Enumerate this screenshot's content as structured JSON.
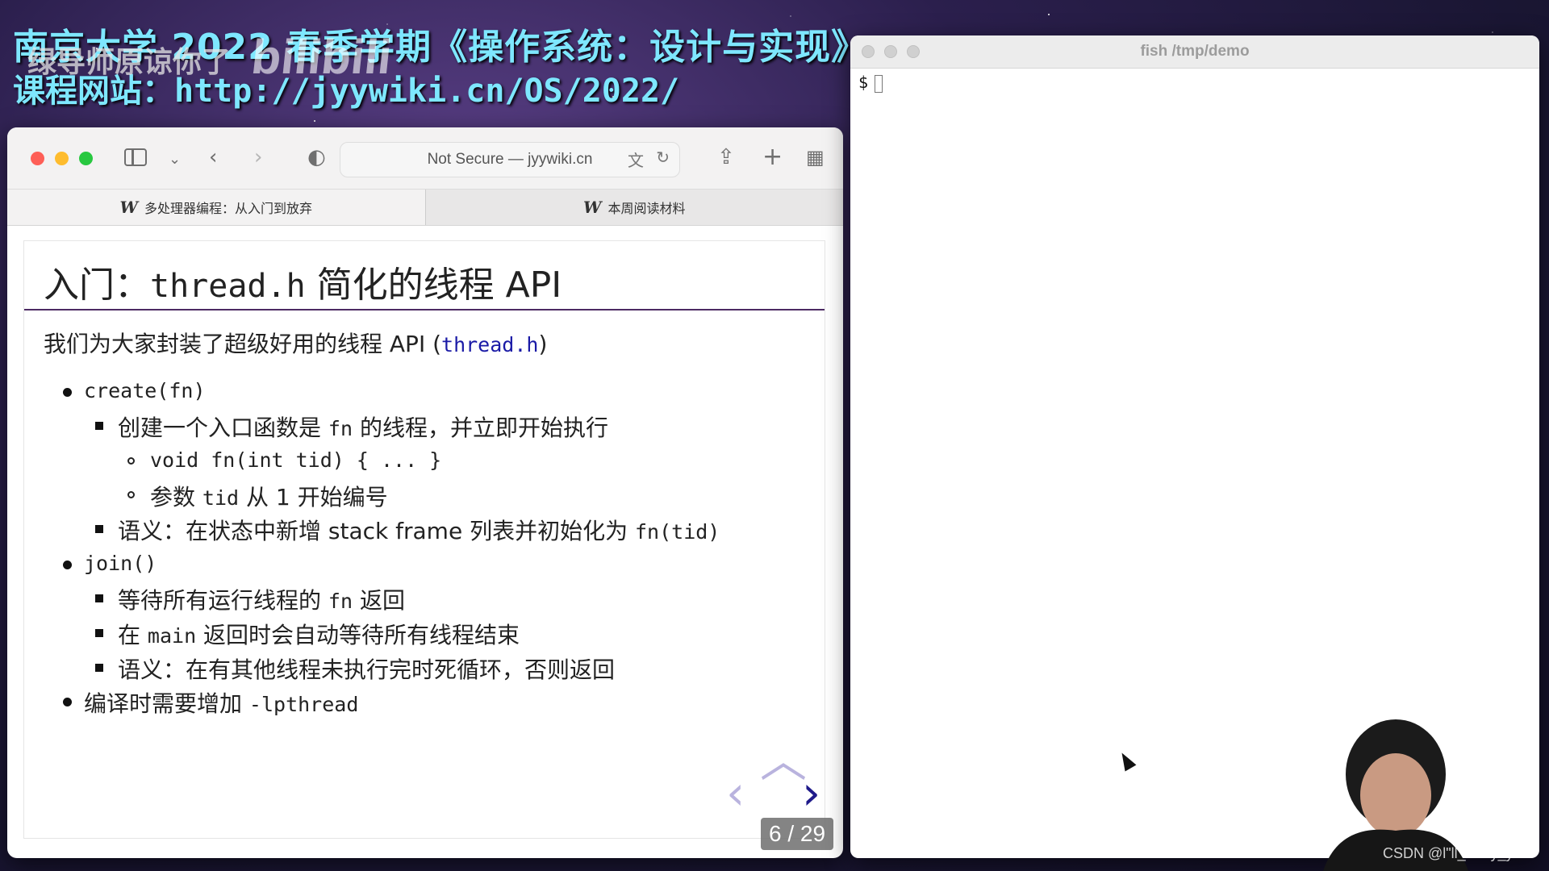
{
  "overlay": {
    "course_title": "南京大学 2022 春季学期《操作系统：设计与实现》",
    "course_site_label": "课程网站：",
    "course_site_url": "http://jyywiki.cn/OS/2022/",
    "uploader": "绿导师原谅你了",
    "platform_logo": "bilibili"
  },
  "browser": {
    "address_text": "Not Secure — jyywiki.cn",
    "tabs": [
      {
        "label": "多处理器编程：从入门到放弃",
        "icon": "wiki-w-icon",
        "active": true
      },
      {
        "label": "本周阅读材料",
        "icon": "wiki-w-icon",
        "active": false
      }
    ]
  },
  "slide": {
    "title_prefix": "入门：",
    "title_code": "thread.h",
    "title_suffix": "简化的线程 API",
    "intro_text": "我们为大家封装了超级好用的线程 API (",
    "intro_code": "thread.h",
    "intro_close": ")",
    "items": {
      "create": "create(fn)",
      "create_desc_a": "创建一个入口函数是",
      "create_desc_code": "fn",
      "create_desc_b": "的线程，并立即开始执行",
      "create_sig": "void fn(int tid) { ... }",
      "create_param_a": "参数",
      "create_param_code": "tid",
      "create_param_b": "从 1 开始编号",
      "create_sem_a": "语义：在状态中新增 stack frame 列表并初始化为",
      "create_sem_code": "fn(tid)",
      "join": "join()",
      "join_wait_a": "等待所有运行线程的",
      "join_wait_code": "fn",
      "join_wait_b": "返回",
      "join_main_a": "在",
      "join_main_code": "main",
      "join_main_b": "返回时会自动等待所有线程结束",
      "join_sem": "语义：在有其他线程未执行完时死循环，否则返回",
      "compile_a": "编译时需要增加",
      "compile_code": "-lpthread"
    },
    "page_indicator": "6 / 29"
  },
  "terminal": {
    "title": "fish /tmp/demo",
    "prompt": "$"
  },
  "watermark": "CSDN @l\"ll_carry_you",
  "colors": {
    "overlay_text": "#7ee7ff",
    "title_rule": "#4d2a63",
    "code_blue": "#1a1aa6",
    "nav_active": "#1f1a8a",
    "nav_inactive": "#b9b3de"
  }
}
